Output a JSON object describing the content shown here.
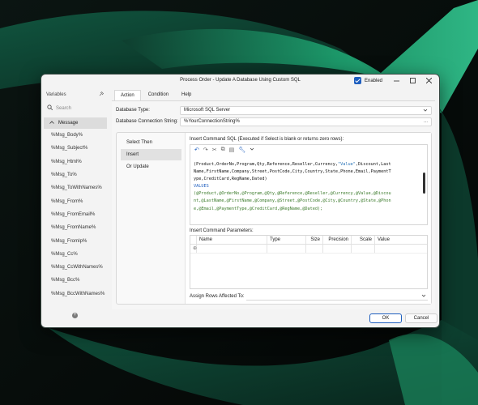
{
  "colors": {
    "accent": "#1f5fbf",
    "wallpaper": "#050807",
    "green_glow": "#1fa874",
    "window_bg": "#f3f3f3",
    "sql_keyword": "#1f5fbf",
    "sql_variable": "#3a7a2a"
  },
  "window": {
    "title": "Process Order - Update A Database Using Custom SQL",
    "enabled_label": "Enabled",
    "enabled_checked": true,
    "icons": [
      "minimize-icon",
      "maximize-icon",
      "close-icon"
    ]
  },
  "variables": {
    "header": "Variables",
    "pin_icon": "pin-icon",
    "search_placeholder": "Search",
    "group_label": "Message",
    "items": [
      "%Msg_Body%",
      "%Msg_Subject%",
      "%Msg_Html%",
      "%Msg_To%",
      "%Msg_ToWithNames%",
      "%Msg_From%",
      "%Msg_FromEmail%",
      "%Msg_FromName%",
      "%Msg_FromIp%",
      "%Msg_Cc%",
      "%Msg_CcWithNames%",
      "%Msg_Bcc%",
      "%Msg_BccWithNames%"
    ],
    "add_icon": "plus-circle-icon"
  },
  "tabs": [
    "Action",
    "Condition",
    "Help"
  ],
  "active_tab": "Action",
  "form": {
    "db_type_label": "Database Type:",
    "db_type_value": "Microsoft SQL Server",
    "conn_label": "Database Connection String:",
    "conn_value": "%YourConnectionString%",
    "conn_more": "..."
  },
  "commands": {
    "items": [
      "Select Then",
      "Insert",
      "Or Update"
    ],
    "active": "Insert"
  },
  "sql": {
    "title": "Insert Command SQL (Executed if Select is blank or returns zero rows):",
    "toolbar_icons": [
      "undo-icon",
      "redo-icon",
      "cut-icon",
      "copy-icon",
      "paste-icon",
      "wrench-icon",
      "chevron-down-icon"
    ],
    "line1": "(Product,OrderNo,Program,Qty,Reference,Reseller,Currency,",
    "line1_str": "\"Value\"",
    "line1_end": ",Discount,Last",
    "line2": "Name,FirstName,Company,Street,PostCode,City,Country,State,Phone,Email,PaymentT",
    "line3": "ype,CreditCard,RegName,Dated)",
    "line4": "VALUES",
    "line5": "(@Product,@OrderNo,@Program,@Qty,@Reference,@Reseller,@Currency,@Value,@Discou",
    "line6": "nt,@LastName,@FirstName,@Company,@Street,@PostCode,@City,@Country,@State,@Phon",
    "line7": "e,@Email,@PaymentType,@CreditCard,@RegName,@Dated);"
  },
  "params": {
    "label": "Insert Command Parameters:",
    "columns": [
      "Name",
      "Type",
      "Size",
      "Precision",
      "Scale",
      "Value"
    ],
    "new_row_marker": "⊕"
  },
  "assign": {
    "label": "Assign Rows Affected To:",
    "value": ""
  },
  "buttons": {
    "ok": "OK",
    "cancel": "Cancel"
  }
}
